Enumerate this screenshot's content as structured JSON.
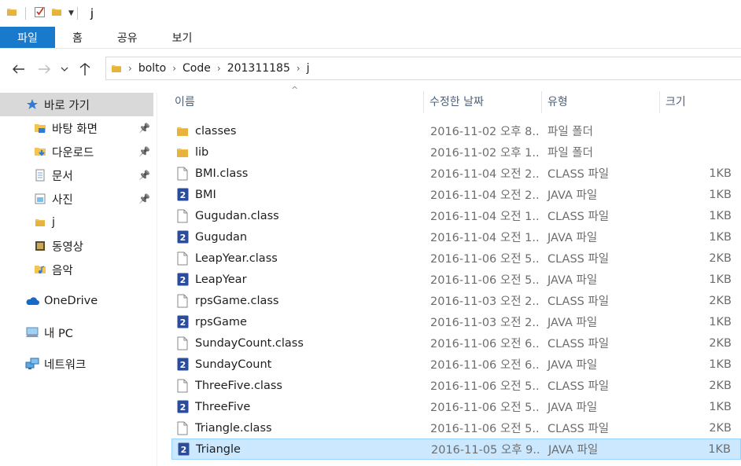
{
  "window": {
    "title": "j"
  },
  "ribbon": {
    "tabs": [
      "파일",
      "홈",
      "공유",
      "보기"
    ]
  },
  "address": {
    "crumbs": [
      "bolto",
      "Code",
      "201311185",
      "j"
    ]
  },
  "sidebar": {
    "quick_access": "바로 가기",
    "pinned": [
      {
        "label": "바탕 화면",
        "icon": "desktop-folder-icon",
        "pinned": true
      },
      {
        "label": "다운로드",
        "icon": "downloads-folder-icon",
        "pinned": true
      },
      {
        "label": "문서",
        "icon": "documents-folder-icon",
        "pinned": true
      },
      {
        "label": "사진",
        "icon": "pictures-folder-icon",
        "pinned": true
      },
      {
        "label": "j",
        "icon": "folder-icon",
        "pinned": false
      },
      {
        "label": "동영상",
        "icon": "videos-folder-icon",
        "pinned": false
      },
      {
        "label": "음악",
        "icon": "music-folder-icon",
        "pinned": false
      }
    ],
    "onedrive": "OneDrive",
    "this_pc": "내 PC",
    "network": "네트워크"
  },
  "columns": {
    "name": "이름",
    "date": "수정한 날짜",
    "type": "유형",
    "size": "크기"
  },
  "files": [
    {
      "name": "classes",
      "date": "2016-11-02 오후 8...",
      "type": "파일 폴더",
      "size": "",
      "kind": "folder"
    },
    {
      "name": "lib",
      "date": "2016-11-02 오후 1...",
      "type": "파일 폴더",
      "size": "",
      "kind": "folder"
    },
    {
      "name": "BMI.class",
      "date": "2016-11-04 오전 2...",
      "type": "CLASS 파일",
      "size": "1KB",
      "kind": "class"
    },
    {
      "name": "BMI",
      "date": "2016-11-04 오전 2...",
      "type": "JAVA 파일",
      "size": "1KB",
      "kind": "java"
    },
    {
      "name": "Gugudan.class",
      "date": "2016-11-04 오전 1...",
      "type": "CLASS 파일",
      "size": "1KB",
      "kind": "class"
    },
    {
      "name": "Gugudan",
      "date": "2016-11-04 오전 1...",
      "type": "JAVA 파일",
      "size": "1KB",
      "kind": "java"
    },
    {
      "name": "LeapYear.class",
      "date": "2016-11-06 오전 5...",
      "type": "CLASS 파일",
      "size": "2KB",
      "kind": "class"
    },
    {
      "name": "LeapYear",
      "date": "2016-11-06 오전 5...",
      "type": "JAVA 파일",
      "size": "1KB",
      "kind": "java"
    },
    {
      "name": "rpsGame.class",
      "date": "2016-11-03 오전 2...",
      "type": "CLASS 파일",
      "size": "2KB",
      "kind": "class"
    },
    {
      "name": "rpsGame",
      "date": "2016-11-03 오전 2...",
      "type": "JAVA 파일",
      "size": "1KB",
      "kind": "java"
    },
    {
      "name": "SundayCount.class",
      "date": "2016-11-06 오전 6...",
      "type": "CLASS 파일",
      "size": "2KB",
      "kind": "class"
    },
    {
      "name": "SundayCount",
      "date": "2016-11-06 오전 6...",
      "type": "JAVA 파일",
      "size": "1KB",
      "kind": "java"
    },
    {
      "name": "ThreeFive.class",
      "date": "2016-11-06 오전 5...",
      "type": "CLASS 파일",
      "size": "2KB",
      "kind": "class"
    },
    {
      "name": "ThreeFive",
      "date": "2016-11-06 오전 5...",
      "type": "JAVA 파일",
      "size": "1KB",
      "kind": "java"
    },
    {
      "name": "Triangle.class",
      "date": "2016-11-06 오전 5...",
      "type": "CLASS 파일",
      "size": "2KB",
      "kind": "class"
    },
    {
      "name": "Triangle",
      "date": "2016-11-05 오후 9...",
      "type": "JAVA 파일",
      "size": "1KB",
      "kind": "java",
      "selected": true
    }
  ],
  "colors": {
    "accent": "#1979ca",
    "selection": "#cce8ff",
    "folder": "#f3c44f",
    "java_icon": "#2b4c9b"
  }
}
